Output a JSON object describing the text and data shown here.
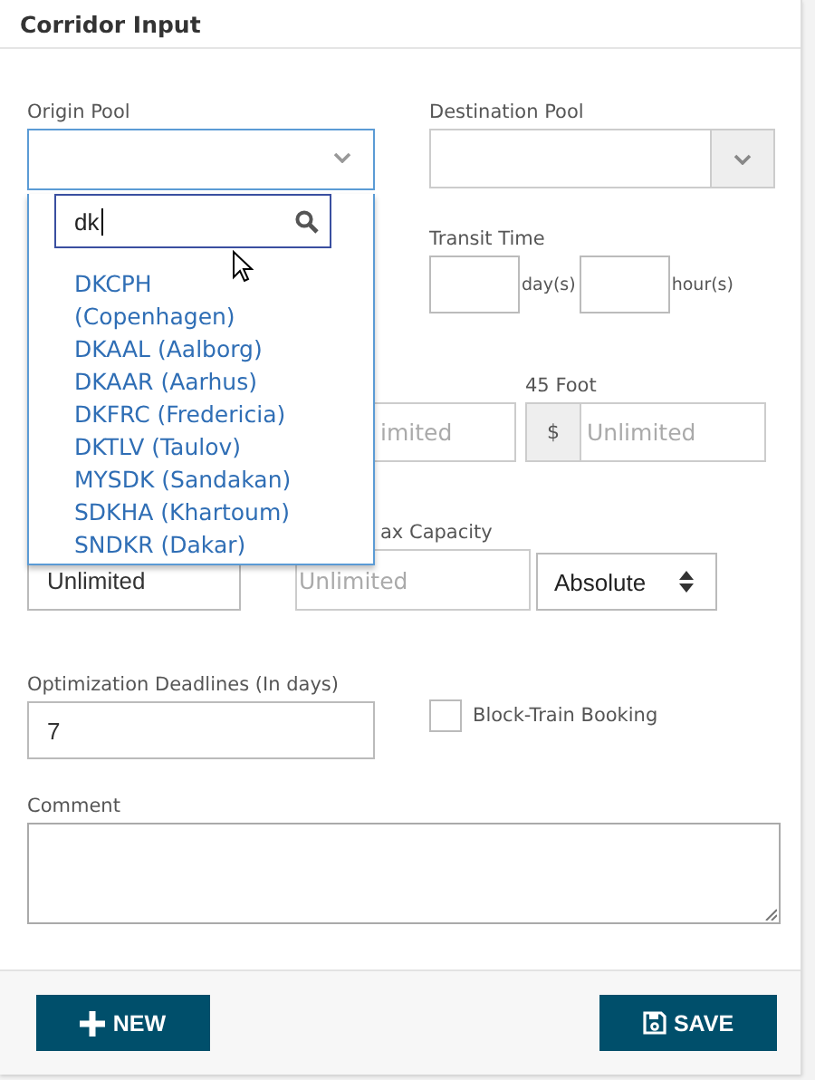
{
  "panel": {
    "title": "Corridor Input"
  },
  "origin_pool": {
    "label": "Origin Pool",
    "open": true,
    "search": {
      "value": "dk"
    },
    "options": [
      {
        "label": "DKCPH (Copenhagen)"
      },
      {
        "label": "DKAAL (Aalborg)"
      },
      {
        "label": "DKAAR (Aarhus)"
      },
      {
        "label": "DKFRC (Fredericia)"
      },
      {
        "label": "DKTLV (Taulov)"
      },
      {
        "label": "MYSDK (Sandakan)"
      },
      {
        "label": "SDKHA (Khartoum)"
      },
      {
        "label": "SNDKR (Dakar)"
      }
    ]
  },
  "destination_pool": {
    "label": "Destination Pool"
  },
  "transit_time": {
    "label": "Transit Time",
    "units": [
      "day(s)",
      "hour(s)"
    ]
  },
  "rates": {
    "field_1": {
      "placeholder": "imited"
    },
    "field_2": {
      "label": "45 Foot",
      "prefix": "$",
      "placeholder": "Unlimited"
    }
  },
  "capacity": {
    "min_value": "Unlimited",
    "max_label": "ax Capacity",
    "max_placeholder": "Unlimited",
    "mode": "Absolute"
  },
  "deadlines": {
    "label": "Optimization Deadlines (In days)",
    "value": "7"
  },
  "block_train": {
    "label": "Block-Train Booking",
    "checked": false
  },
  "comment": {
    "label": "Comment"
  },
  "buttons": [
    {
      "kind": "new",
      "label": "NEW"
    },
    {
      "kind": "save",
      "label": "SAVE"
    }
  ]
}
